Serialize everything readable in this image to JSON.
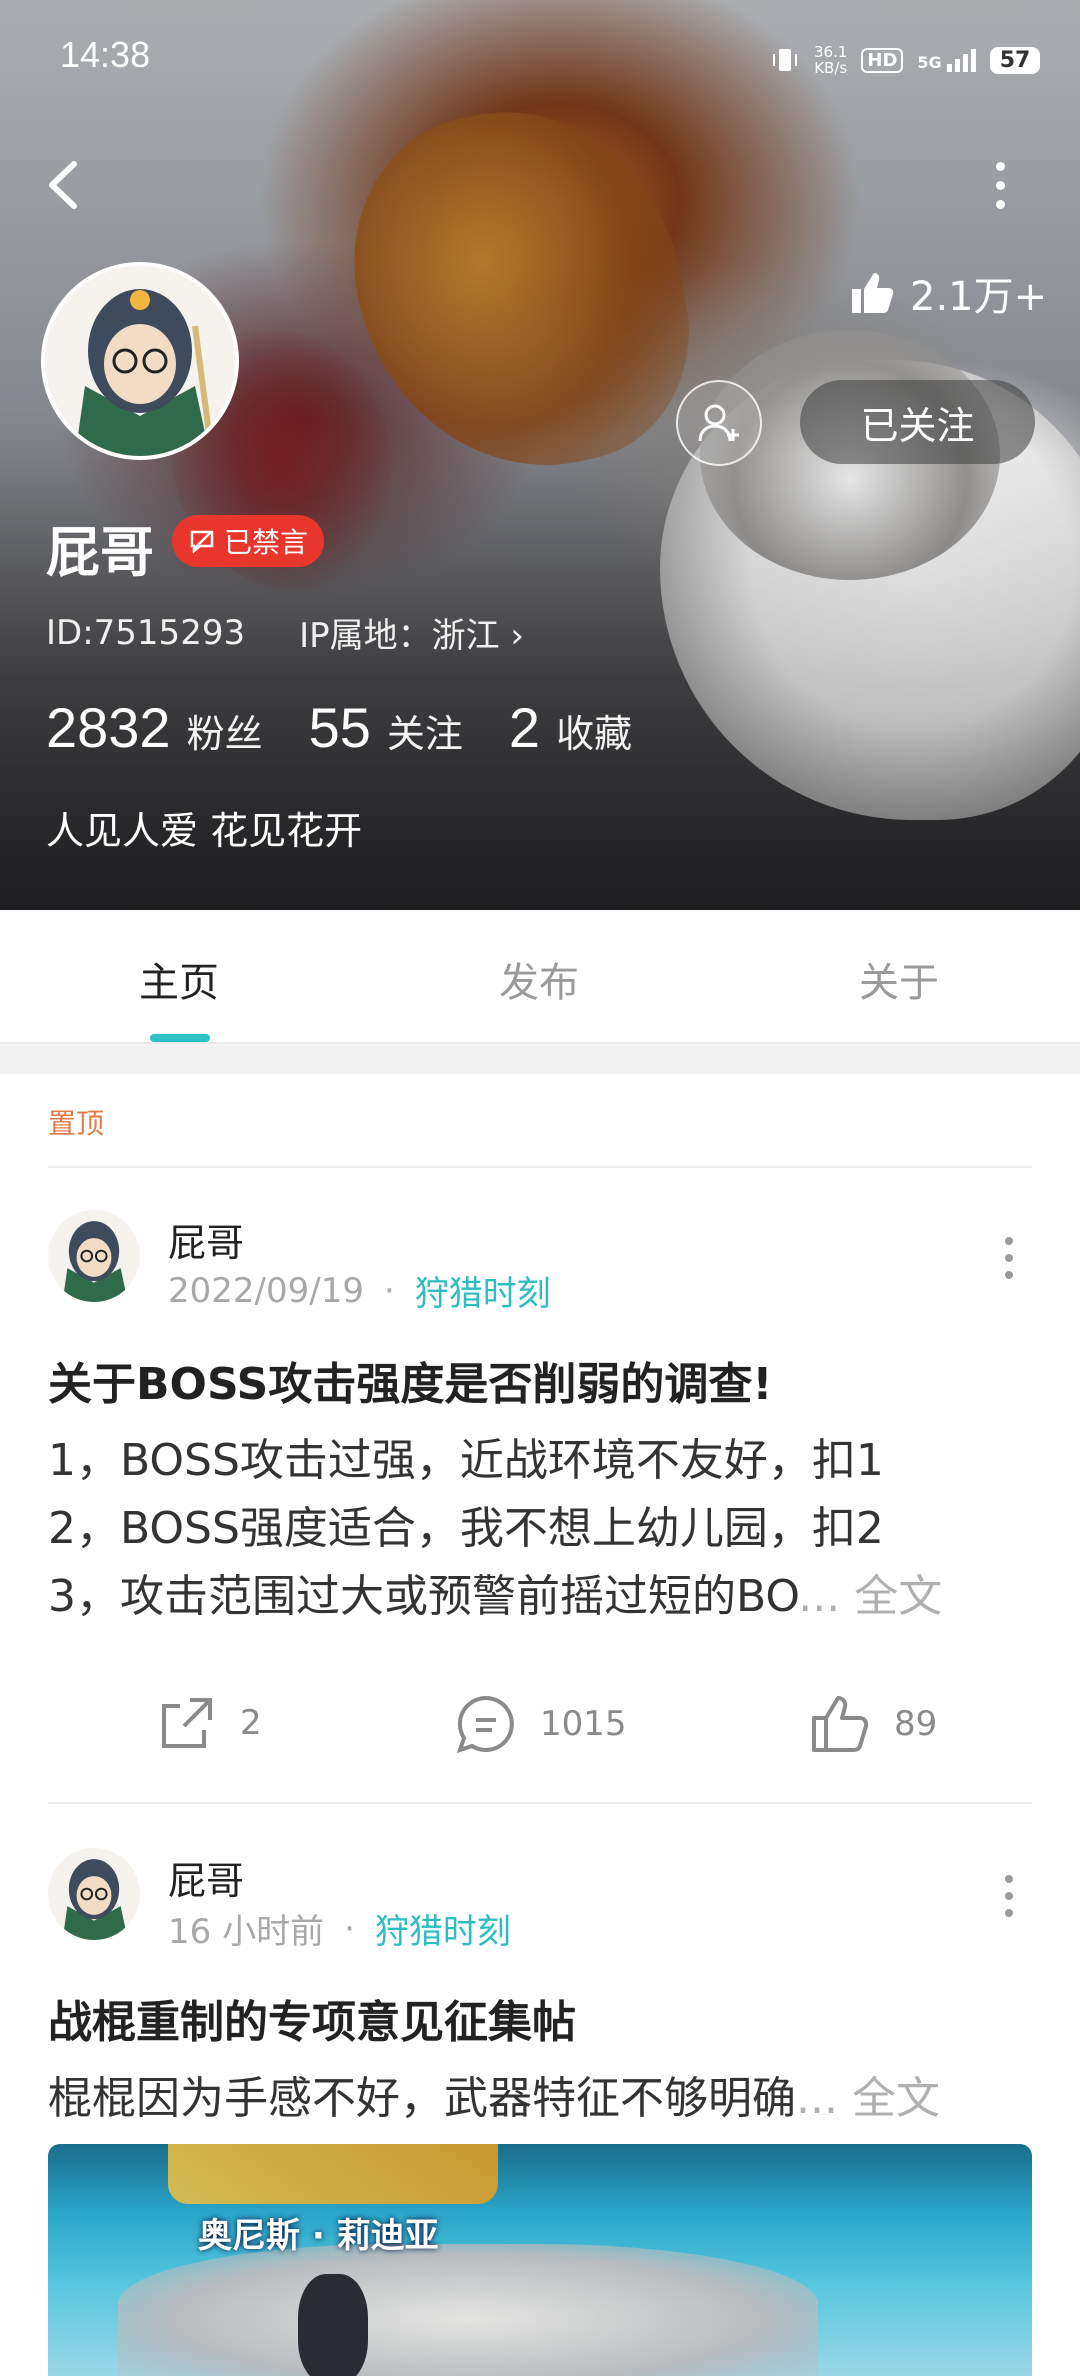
{
  "status_bar": {
    "time": "14:38",
    "network_speed": "36.1\nKB/s",
    "hd_label": "HD",
    "signal_label": "5G",
    "battery": "57"
  },
  "profile": {
    "likes": "2.1万+",
    "follow_button": "已关注",
    "username": "屁哥",
    "ban_badge": "已禁言",
    "id_text": "ID:7515293",
    "ip_text": "IP属地：浙江 ›",
    "stats": [
      {
        "value": "2832",
        "label": "粉丝"
      },
      {
        "value": "55",
        "label": "关注"
      },
      {
        "value": "2",
        "label": "收藏"
      }
    ],
    "bio": "人见人爱 花见花开"
  },
  "tabs": [
    {
      "label": "主页",
      "active": true
    },
    {
      "label": "发布",
      "active": false
    },
    {
      "label": "关于",
      "active": false
    }
  ],
  "pinned_label": "置顶",
  "posts": [
    {
      "author": "屁哥",
      "date": "2022/09/19",
      "separator": "·",
      "topic": "狩猎时刻",
      "title": "关于BOSS攻击强度是否削弱的调查!",
      "lines": [
        "1，BOSS攻击过强，近战环境不友好，扣1",
        "2，BOSS强度适合，我不想上幼儿园，扣2",
        "3，攻击范围过大或预警前摇过短的BO"
      ],
      "ellipsis": "... ",
      "fulltext": "全文",
      "share_count": "2",
      "comment_count": "1015",
      "like_count": "89"
    },
    {
      "author": "屁哥",
      "date": "16 小时前",
      "separator": "·",
      "topic": "狩猎时刻",
      "title": "战棍重制的专项意见征集帖",
      "lines": [
        "棍棍因为手感不好，武器特征不够明确"
      ],
      "ellipsis": "... ",
      "fulltext": "全文",
      "image_text": "奥尼斯 · 莉迪亚"
    }
  ],
  "colors": {
    "accent": "#2dc1c6",
    "ban_badge": "#e8362d",
    "pinned": "#e07a4a",
    "topic": "#2dbdc2"
  },
  "icons": [
    "back-arrow-icon",
    "more-vertical-icon",
    "thumb-up-icon",
    "add-friend-icon",
    "chat-bubble-icon",
    "share-icon",
    "comment-icon",
    "like-icon"
  ]
}
